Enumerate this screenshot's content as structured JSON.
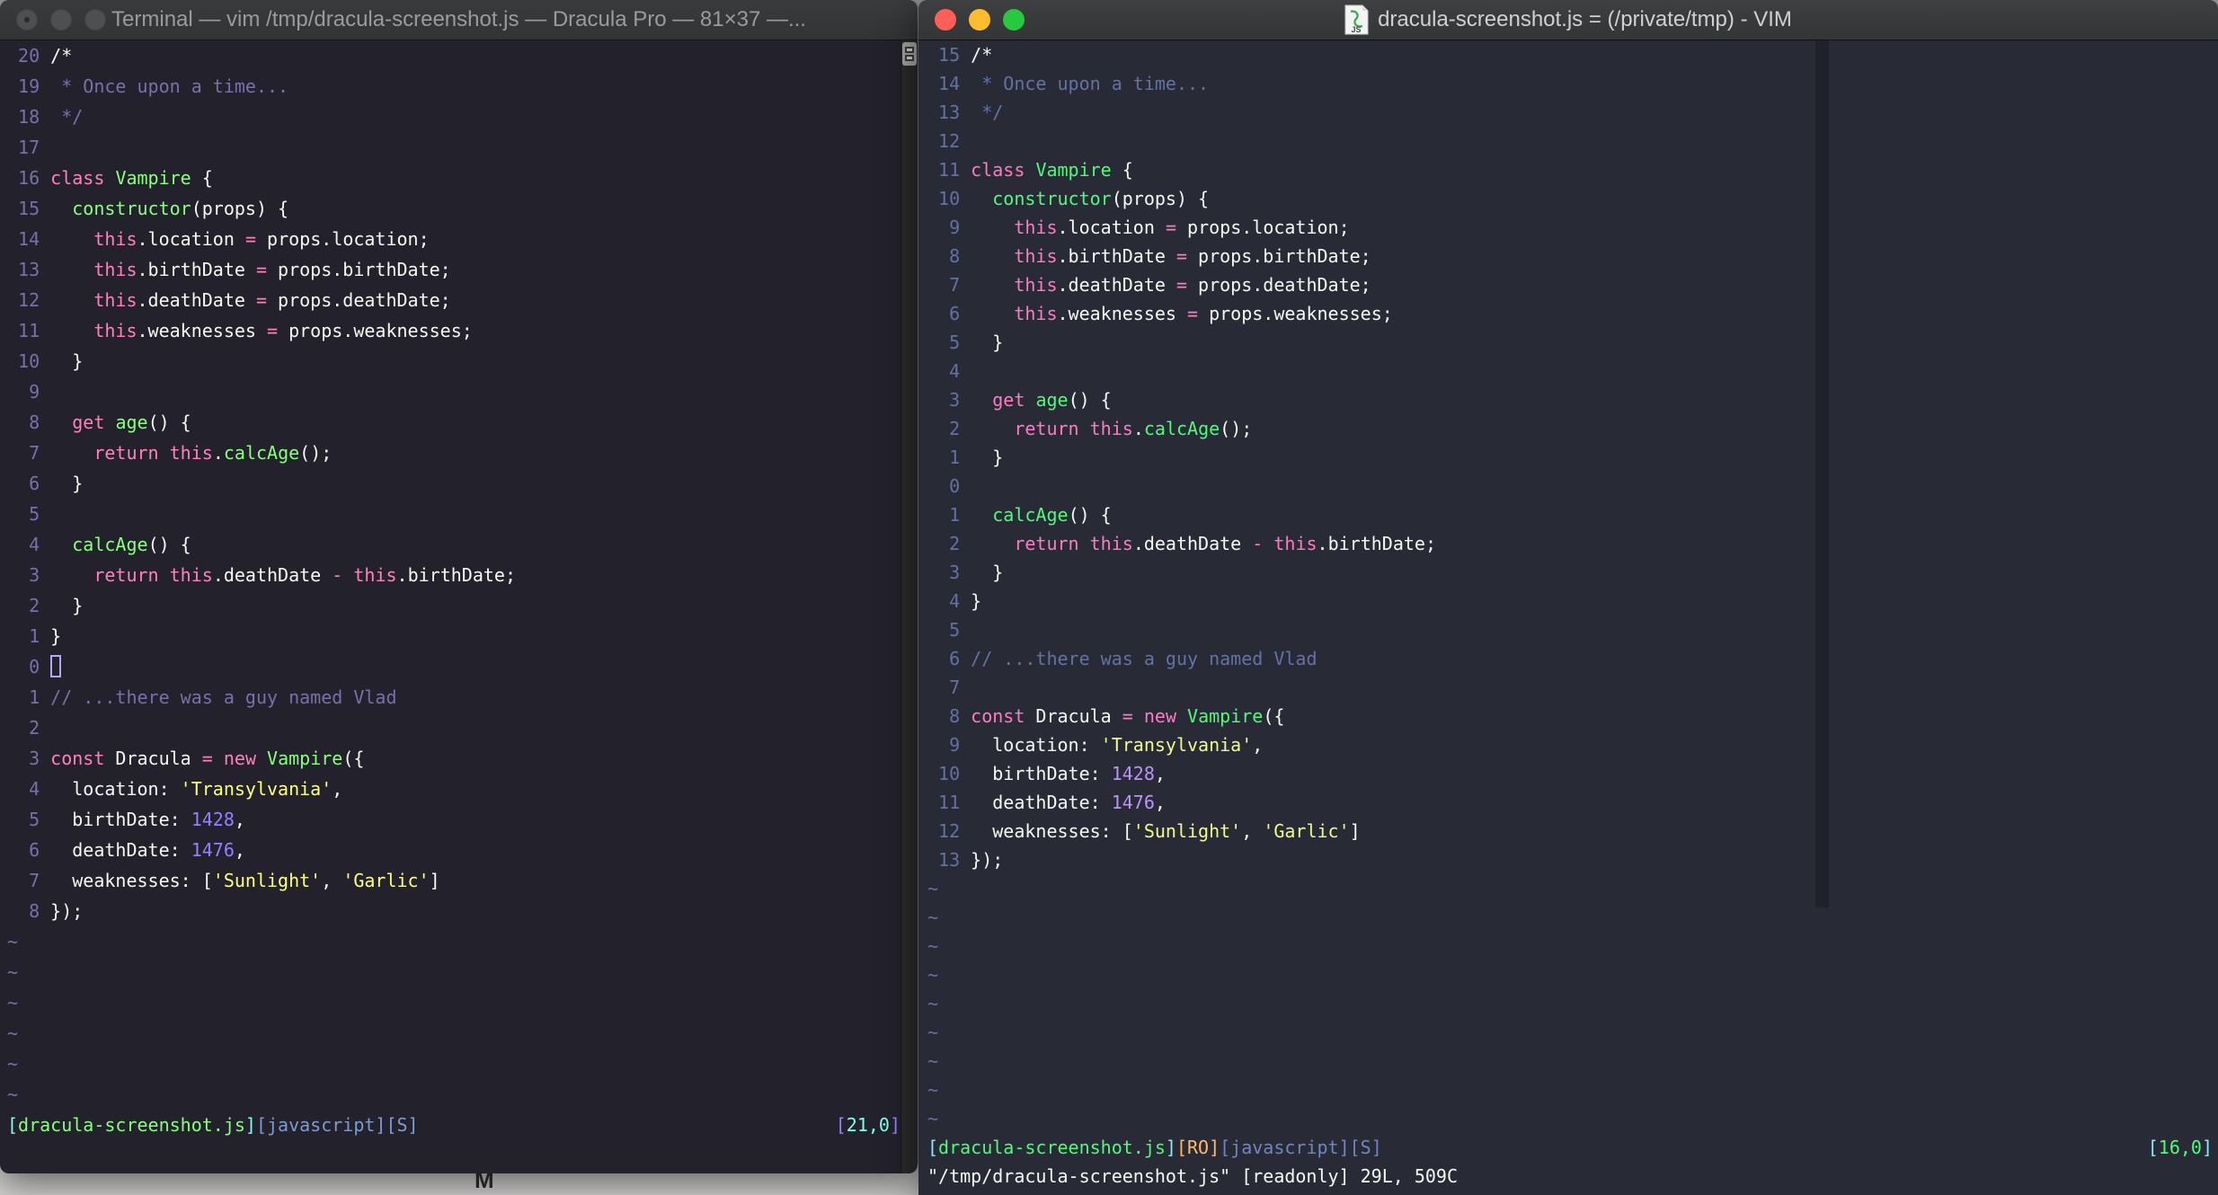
{
  "background": {
    "partial_text": "M"
  },
  "palettes": {
    "left": {
      "bg": "#22212C",
      "fg": "#F8F8F2",
      "cm": "#7970A9",
      "pk": "#FF80BF",
      "gr": "#8AFF80",
      "yl": "#FFFF80",
      "pu": "#9580FF",
      "cy": "#80FFEA",
      "sb": "#7E9BD0",
      "or": "#FFCA80"
    },
    "right": {
      "bg": "#282A36",
      "fg": "#F8F8F2",
      "cm": "#6272A4",
      "pk": "#FF79C6",
      "gr": "#50FA7B",
      "yl": "#F1FA8C",
      "pu": "#BD93F9",
      "cy": "#8BE9FD",
      "sb": "#6E87C0",
      "or": "#FFB86C"
    }
  },
  "left_window": {
    "title": "Terminal — vim /tmp/dracula-screenshot.js — Dracula Pro — 81×37 —...",
    "tilde": "~",
    "tilde_count": 6,
    "lines": [
      {
        "n": "20",
        "s": [
          [
            "fg",
            "/*"
          ]
        ]
      },
      {
        "n": "19",
        "s": [
          [
            "cm",
            " * Once upon a time..."
          ]
        ]
      },
      {
        "n": "18",
        "s": [
          [
            "cm",
            " */"
          ]
        ]
      },
      {
        "n": "17",
        "s": []
      },
      {
        "n": "16",
        "s": [
          [
            "pk",
            "class"
          ],
          [
            "fg",
            " "
          ],
          [
            "gr",
            "Vampire"
          ],
          [
            "fg",
            " {"
          ]
        ]
      },
      {
        "n": "15",
        "s": [
          [
            "fg",
            "  "
          ],
          [
            "gr",
            "constructor"
          ],
          [
            "fg",
            "(props) {"
          ]
        ]
      },
      {
        "n": "14",
        "s": [
          [
            "fg",
            "    "
          ],
          [
            "pk",
            "this"
          ],
          [
            "fg",
            ".location "
          ],
          [
            "pk",
            "="
          ],
          [
            "fg",
            " props.location;"
          ]
        ]
      },
      {
        "n": "13",
        "s": [
          [
            "fg",
            "    "
          ],
          [
            "pk",
            "this"
          ],
          [
            "fg",
            ".birthDate "
          ],
          [
            "pk",
            "="
          ],
          [
            "fg",
            " props.birthDate;"
          ]
        ]
      },
      {
        "n": "12",
        "s": [
          [
            "fg",
            "    "
          ],
          [
            "pk",
            "this"
          ],
          [
            "fg",
            ".deathDate "
          ],
          [
            "pk",
            "="
          ],
          [
            "fg",
            " props.deathDate;"
          ]
        ]
      },
      {
        "n": "11",
        "s": [
          [
            "fg",
            "    "
          ],
          [
            "pk",
            "this"
          ],
          [
            "fg",
            ".weaknesses "
          ],
          [
            "pk",
            "="
          ],
          [
            "fg",
            " props.weaknesses;"
          ]
        ]
      },
      {
        "n": "10",
        "s": [
          [
            "fg",
            "  }"
          ]
        ]
      },
      {
        "n": "9",
        "s": []
      },
      {
        "n": "8",
        "s": [
          [
            "fg",
            "  "
          ],
          [
            "pk",
            "get"
          ],
          [
            "fg",
            " "
          ],
          [
            "gr",
            "age"
          ],
          [
            "fg",
            "() {"
          ]
        ]
      },
      {
        "n": "7",
        "s": [
          [
            "fg",
            "    "
          ],
          [
            "pk",
            "return"
          ],
          [
            "fg",
            " "
          ],
          [
            "pk",
            "this"
          ],
          [
            "fg",
            "."
          ],
          [
            "gr",
            "calcAge"
          ],
          [
            "fg",
            "();"
          ]
        ]
      },
      {
        "n": "6",
        "s": [
          [
            "fg",
            "  }"
          ]
        ]
      },
      {
        "n": "5",
        "s": []
      },
      {
        "n": "4",
        "s": [
          [
            "fg",
            "  "
          ],
          [
            "gr",
            "calcAge"
          ],
          [
            "fg",
            "() {"
          ]
        ]
      },
      {
        "n": "3",
        "s": [
          [
            "fg",
            "    "
          ],
          [
            "pk",
            "return"
          ],
          [
            "fg",
            " "
          ],
          [
            "pk",
            "this"
          ],
          [
            "fg",
            ".deathDate "
          ],
          [
            "pk",
            "-"
          ],
          [
            "fg",
            " "
          ],
          [
            "pk",
            "this"
          ],
          [
            "fg",
            ".birthDate;"
          ]
        ]
      },
      {
        "n": "2",
        "s": [
          [
            "fg",
            "  }"
          ]
        ]
      },
      {
        "n": "1",
        "s": [
          [
            "fg",
            "}"
          ]
        ]
      },
      {
        "n": "0",
        "s": [
          [
            "cur",
            ""
          ]
        ]
      },
      {
        "n": "1",
        "s": [
          [
            "cm",
            "// ...there was a guy named Vlad"
          ]
        ]
      },
      {
        "n": "2",
        "s": []
      },
      {
        "n": "3",
        "s": [
          [
            "pk",
            "const"
          ],
          [
            "fg",
            " Dracula "
          ],
          [
            "pk",
            "="
          ],
          [
            "fg",
            " "
          ],
          [
            "pk",
            "new"
          ],
          [
            "fg",
            " "
          ],
          [
            "gr",
            "Vampire"
          ],
          [
            "fg",
            "({"
          ]
        ]
      },
      {
        "n": "4",
        "s": [
          [
            "fg",
            "  location: "
          ],
          [
            "yl",
            "'Transylvania'"
          ],
          [
            "fg",
            ","
          ]
        ]
      },
      {
        "n": "5",
        "s": [
          [
            "fg",
            "  birthDate: "
          ],
          [
            "pu",
            "1428"
          ],
          [
            "fg",
            ","
          ]
        ]
      },
      {
        "n": "6",
        "s": [
          [
            "fg",
            "  deathDate: "
          ],
          [
            "pu",
            "1476"
          ],
          [
            "fg",
            ","
          ]
        ]
      },
      {
        "n": "7",
        "s": [
          [
            "fg",
            "  weaknesses: ["
          ],
          [
            "yl",
            "'Sunlight'"
          ],
          [
            "fg",
            ", "
          ],
          [
            "yl",
            "'Garlic'"
          ],
          [
            "fg",
            "]"
          ]
        ]
      },
      {
        "n": "8",
        "s": [
          [
            "fg",
            "});"
          ]
        ]
      }
    ],
    "status_left": [
      [
        "cy",
        "["
      ],
      [
        "gr",
        "dracula-screenshot.js"
      ],
      [
        "cy",
        "]"
      ],
      [
        "sb",
        "[javascript][S]"
      ]
    ],
    "status_right": [
      [
        "pu",
        "["
      ],
      [
        "cy",
        "21,0"
      ],
      [
        "pu",
        "]"
      ]
    ],
    "cmdline": []
  },
  "right_window": {
    "title": "dracula-screenshot.js = (/private/tmp) - VIM",
    "doc_icon_label": "JS",
    "tilde": "~",
    "tilde_count": 9,
    "lines": [
      {
        "n": "15",
        "s": [
          [
            "fg",
            "/*"
          ]
        ]
      },
      {
        "n": "14",
        "s": [
          [
            "cm",
            " * Once upon a time..."
          ]
        ]
      },
      {
        "n": "13",
        "s": [
          [
            "cm",
            " */"
          ]
        ]
      },
      {
        "n": "12",
        "s": []
      },
      {
        "n": "11",
        "s": [
          [
            "pk",
            "class"
          ],
          [
            "fg",
            " "
          ],
          [
            "gr",
            "Vampire"
          ],
          [
            "fg",
            " {"
          ]
        ]
      },
      {
        "n": "10",
        "s": [
          [
            "fg",
            "  "
          ],
          [
            "gr",
            "constructor"
          ],
          [
            "fg",
            "(props) {"
          ]
        ]
      },
      {
        "n": "9",
        "s": [
          [
            "fg",
            "    "
          ],
          [
            "pk",
            "this"
          ],
          [
            "fg",
            ".location "
          ],
          [
            "pk",
            "="
          ],
          [
            "fg",
            " props.location;"
          ]
        ]
      },
      {
        "n": "8",
        "s": [
          [
            "fg",
            "    "
          ],
          [
            "pk",
            "this"
          ],
          [
            "fg",
            ".birthDate "
          ],
          [
            "pk",
            "="
          ],
          [
            "fg",
            " props.birthDate;"
          ]
        ]
      },
      {
        "n": "7",
        "s": [
          [
            "fg",
            "    "
          ],
          [
            "pk",
            "this"
          ],
          [
            "fg",
            ".deathDate "
          ],
          [
            "pk",
            "="
          ],
          [
            "fg",
            " props.deathDate;"
          ]
        ]
      },
      {
        "n": "6",
        "s": [
          [
            "fg",
            "    "
          ],
          [
            "pk",
            "this"
          ],
          [
            "fg",
            ".weaknesses "
          ],
          [
            "pk",
            "="
          ],
          [
            "fg",
            " props.weaknesses;"
          ]
        ]
      },
      {
        "n": "5",
        "s": [
          [
            "fg",
            "  }"
          ]
        ]
      },
      {
        "n": "4",
        "s": []
      },
      {
        "n": "3",
        "s": [
          [
            "fg",
            "  "
          ],
          [
            "pk",
            "get"
          ],
          [
            "fg",
            " "
          ],
          [
            "gr",
            "age"
          ],
          [
            "fg",
            "() {"
          ]
        ]
      },
      {
        "n": "2",
        "s": [
          [
            "fg",
            "    "
          ],
          [
            "pk",
            "return"
          ],
          [
            "fg",
            " "
          ],
          [
            "pk",
            "this"
          ],
          [
            "fg",
            "."
          ],
          [
            "gr",
            "calcAge"
          ],
          [
            "fg",
            "();"
          ]
        ]
      },
      {
        "n": "1",
        "s": [
          [
            "fg",
            "  }"
          ]
        ]
      },
      {
        "n": "0",
        "s": []
      },
      {
        "n": "1",
        "s": [
          [
            "fg",
            "  "
          ],
          [
            "gr",
            "calcAge"
          ],
          [
            "fg",
            "() {"
          ]
        ]
      },
      {
        "n": "2",
        "s": [
          [
            "fg",
            "    "
          ],
          [
            "pk",
            "return"
          ],
          [
            "fg",
            " "
          ],
          [
            "pk",
            "this"
          ],
          [
            "fg",
            ".deathDate "
          ],
          [
            "pk",
            "-"
          ],
          [
            "fg",
            " "
          ],
          [
            "pk",
            "this"
          ],
          [
            "fg",
            ".birthDate;"
          ]
        ]
      },
      {
        "n": "3",
        "s": [
          [
            "fg",
            "  }"
          ]
        ]
      },
      {
        "n": "4",
        "s": [
          [
            "fg",
            "}"
          ]
        ]
      },
      {
        "n": "5",
        "s": []
      },
      {
        "n": "6",
        "s": [
          [
            "cm",
            "// ...there was a guy named Vlad"
          ]
        ]
      },
      {
        "n": "7",
        "s": []
      },
      {
        "n": "8",
        "s": [
          [
            "pk",
            "const"
          ],
          [
            "fg",
            " Dracula "
          ],
          [
            "pk",
            "="
          ],
          [
            "fg",
            " "
          ],
          [
            "pk",
            "new"
          ],
          [
            "fg",
            " "
          ],
          [
            "gr",
            "Vampire"
          ],
          [
            "fg",
            "({"
          ]
        ]
      },
      {
        "n": "9",
        "s": [
          [
            "fg",
            "  location: "
          ],
          [
            "yl",
            "'Transylvania'"
          ],
          [
            "fg",
            ","
          ]
        ]
      },
      {
        "n": "10",
        "s": [
          [
            "fg",
            "  birthDate: "
          ],
          [
            "pu",
            "1428"
          ],
          [
            "fg",
            ","
          ]
        ]
      },
      {
        "n": "11",
        "s": [
          [
            "fg",
            "  deathDate: "
          ],
          [
            "pu",
            "1476"
          ],
          [
            "fg",
            ","
          ]
        ]
      },
      {
        "n": "12",
        "s": [
          [
            "fg",
            "  weaknesses: ["
          ],
          [
            "yl",
            "'Sunlight'"
          ],
          [
            "fg",
            ", "
          ],
          [
            "yl",
            "'Garlic'"
          ],
          [
            "fg",
            "]"
          ]
        ]
      },
      {
        "n": "13",
        "s": [
          [
            "fg",
            "});"
          ]
        ]
      }
    ],
    "status_left": [
      [
        "cy",
        "["
      ],
      [
        "gr",
        "dracula-screenshot.js"
      ],
      [
        "cy",
        "]"
      ],
      [
        "or",
        "[RO]"
      ],
      [
        "sb",
        "[javascript][S]"
      ]
    ],
    "status_right": [
      [
        "cy",
        "["
      ],
      [
        "gr",
        "16,0"
      ],
      [
        "cy",
        "]"
      ]
    ],
    "cmdline": [
      [
        "fg",
        "\"/tmp/dracula-screenshot.js\" [readonly] 29L, 509C"
      ]
    ]
  }
}
